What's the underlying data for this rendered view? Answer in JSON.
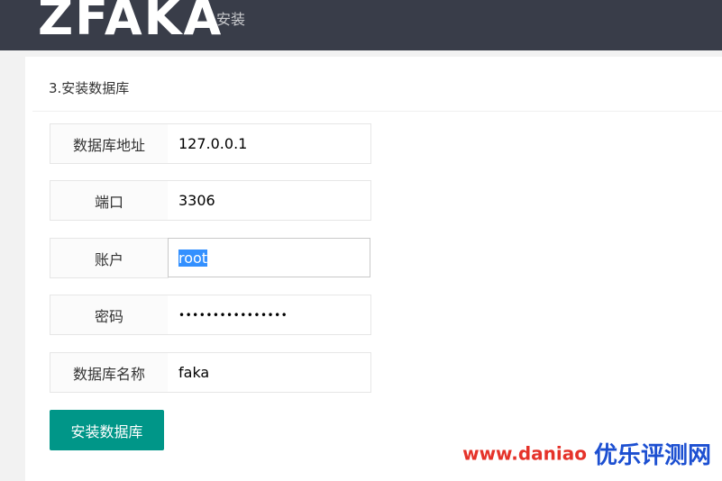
{
  "header": {
    "logo": "ZFAKA",
    "nav_install": "安装"
  },
  "panel": {
    "title": "3.安装数据库"
  },
  "form": {
    "host": {
      "label": "数据库地址",
      "value": "127.0.0.1"
    },
    "port": {
      "label": "端口",
      "value": "3306"
    },
    "user": {
      "label": "账户",
      "value": "root"
    },
    "password": {
      "label": "密码",
      "value": "••••••••••••••••"
    },
    "dbname": {
      "label": "数据库名称",
      "value": "faka"
    }
  },
  "buttons": {
    "install_label": "安装数据库"
  },
  "watermark": {
    "url": "www.daniao",
    "brand": "优乐评测网"
  },
  "colors": {
    "header_bg": "#393d49",
    "primary": "#009688",
    "selection": "#3390ff"
  }
}
